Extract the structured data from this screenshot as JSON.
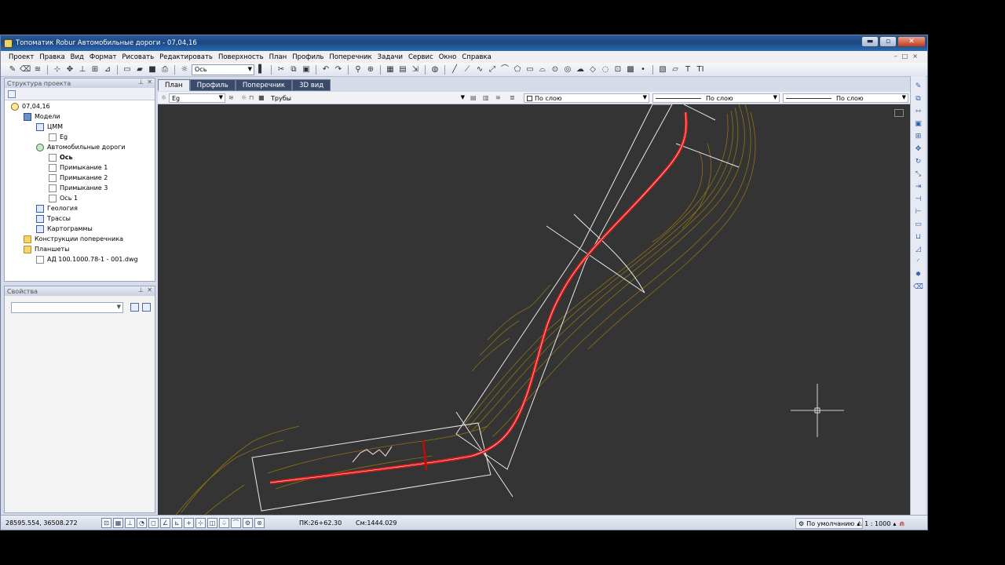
{
  "window": {
    "title": "Топоматик Robur Автомобильные дороги - 07,04,16",
    "minimize": "▬",
    "maximize": "▫",
    "close": "✕"
  },
  "menu": [
    "Проект",
    "Правка",
    "Вид",
    "Формат",
    "Рисовать",
    "Редактировать",
    "Поверхность",
    "План",
    "Профиль",
    "Поперечник",
    "Задачи",
    "Сервис",
    "Окно",
    "Справка"
  ],
  "toolbar": {
    "object_combo": "Ось",
    "text_tool": "T",
    "text_tool2": "TI"
  },
  "project_panel": {
    "title": "Структура проекта",
    "tree": [
      {
        "label": "07,04,16",
        "icon": "proj"
      },
      {
        "label": "Модели",
        "icon": "models"
      },
      {
        "label": "ЦММ",
        "icon": "grid"
      },
      {
        "label": "Eg",
        "icon": "doc"
      },
      {
        "label": "Автомобильные дороги",
        "icon": "road"
      },
      {
        "label": "Ось",
        "icon": "doc"
      },
      {
        "label": "Примыкание 1",
        "icon": "doc"
      },
      {
        "label": "Примыкание 2",
        "icon": "doc"
      },
      {
        "label": "Примыкание 3",
        "icon": "doc"
      },
      {
        "label": "Ось 1",
        "icon": "doc"
      },
      {
        "label": "Геология",
        "icon": "grid"
      },
      {
        "label": "Трассы",
        "icon": "grid"
      },
      {
        "label": "Картограммы",
        "icon": "grid"
      },
      {
        "label": "Конструкции поперечника",
        "icon": "folder"
      },
      {
        "label": "Планшеты",
        "icon": "folder"
      },
      {
        "label": "АД 100.1000.78-1 - 001.dwg",
        "icon": "doc"
      }
    ]
  },
  "properties_panel": {
    "title": "Свойства",
    "select_value": ""
  },
  "tabs": [
    "План",
    "Профиль",
    "Поперечник",
    "3D вид"
  ],
  "layer_bar": {
    "surface": "Eg",
    "layer": "Трубы",
    "color": "По слою",
    "linetype": "По слою",
    "lineweight": "По слою"
  },
  "status_bar": {
    "coords": "28595.554, 36508.272",
    "pk": "ПК:26+62.30",
    "sm": "Cм:1444.029",
    "style": "По умолчанию",
    "scale": "1 : 1000"
  },
  "colors": {
    "canvas_bg": "#343434",
    "road_axis": "#e01818",
    "contours": "#8f7211",
    "boundary": "#e8e8e8",
    "crosshair": "#ffffff"
  }
}
